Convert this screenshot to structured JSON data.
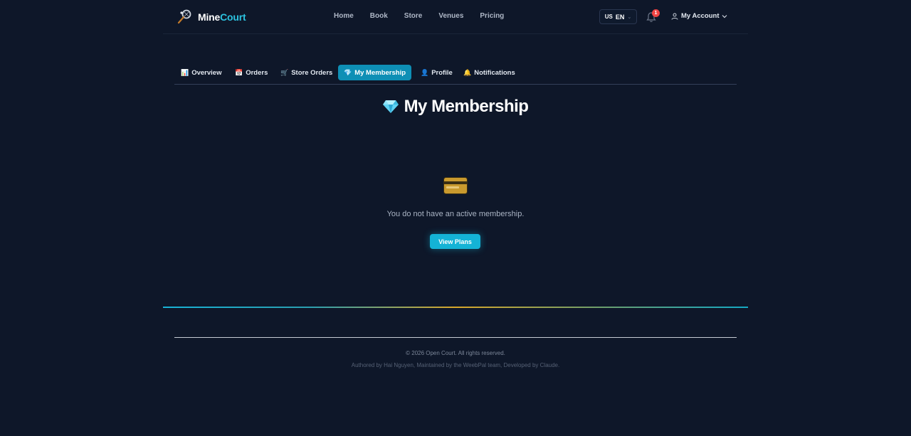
{
  "header": {
    "brand_part1": "Mine",
    "brand_part2": "Court",
    "nav": [
      "Home",
      "Book",
      "Store",
      "Venues",
      "Pricing"
    ],
    "language_code": "US",
    "language": "EN",
    "notification_count": "1",
    "account_label": "My Account"
  },
  "tabs": [
    {
      "emoji": "📊",
      "label": "Overview",
      "active": false
    },
    {
      "emoji": "📅",
      "label": "Orders",
      "active": false
    },
    {
      "emoji": "🛒",
      "label": "Store Orders",
      "active": false
    },
    {
      "emoji": "💎",
      "label": "My Membership",
      "active": true
    },
    {
      "emoji": "👤",
      "label": "Profile",
      "active": false
    },
    {
      "emoji": "🔔",
      "label": "Notifications",
      "active": false
    }
  ],
  "main": {
    "title": "My Membership",
    "empty_message": "You do not have an active membership.",
    "view_plans_label": "View Plans"
  },
  "footer": {
    "copyright": "© 2026 Open Court. All rights reserved.",
    "credits": "Authored by Hai Nguyen, Maintained by the WeebPal team, Developed by Claude."
  },
  "colors": {
    "background": "#0e1729",
    "accent": "#14b3d6",
    "active_tab": "#0e8fb5",
    "badge": "#ef4444"
  },
  "icons": [
    "racket-logo-icon",
    "chevron-down-icon",
    "bell-icon",
    "user-icon",
    "gem-icon",
    "credit-card-icon"
  ]
}
